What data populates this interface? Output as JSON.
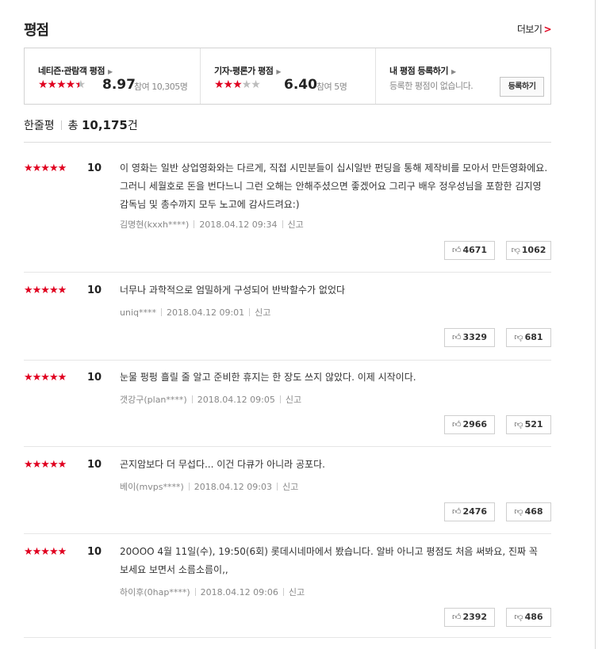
{
  "header": {
    "title": "평점",
    "more_label": "더보기",
    "more_arrow": ">"
  },
  "rating_box": {
    "netizen": {
      "label": "네티즌·관람객 평점",
      "score": "8.97",
      "participants": "참여 10,305명",
      "stars": 4.5
    },
    "critic": {
      "label": "기자·평론가 평점",
      "score": "6.40",
      "participants": "참여 5명",
      "stars": 3
    },
    "my": {
      "label": "내 평점 등록하기",
      "note": "등록한 평점이 없습니다.",
      "button": "등록하기"
    }
  },
  "summary": {
    "label": "한줄평",
    "total_prefix": "총",
    "total_count": "10,175",
    "total_suffix": "건"
  },
  "colors": {
    "accent": "#e0001f",
    "star_off": "#bdbdbd"
  },
  "reviews": [
    {
      "stars": "★★★★★",
      "score": "10",
      "text": "이 영화는 일반 상업영화와는 다르게, 직접 시민분들이 십시일반 펀딩을 통해 제작비를 모아서 만든영화에요.그러니 세월호로 돈을 번다느니 그런 오해는 안해주셨으면 좋겠어요 그리구 배우 정우성님을 포함한 김지영감독님 및 총수까지 모두 노고에 감사드려요:)",
      "author": "김명현(kxxh****)",
      "date": "2018.04.12 09:34",
      "report": "신고",
      "likes": "4671",
      "dislikes": "1062"
    },
    {
      "stars": "★★★★★",
      "score": "10",
      "text": "너무나 과학적으로 엄밀하게 구성되어 반박할수가 없었다",
      "author": "uniq****",
      "date": "2018.04.12 09:01",
      "report": "신고",
      "likes": "3329",
      "dislikes": "681"
    },
    {
      "stars": "★★★★★",
      "score": "10",
      "text": "눈물 펑펑 흘릴 줄 알고 준비한 휴지는 한 장도 쓰지 않았다. 이제 시작이다.",
      "author": "갯강구(plan****)",
      "date": "2018.04.12 09:05",
      "report": "신고",
      "likes": "2966",
      "dislikes": "521"
    },
    {
      "stars": "★★★★★",
      "score": "10",
      "text": "곤지암보다 더 무섭다... 이건 다큐가 아니라 공포다.",
      "author": "베이(mvps****)",
      "date": "2018.04.12 09:03",
      "report": "신고",
      "likes": "2476",
      "dislikes": "468"
    },
    {
      "stars": "★★★★★",
      "score": "10",
      "text": "20OOO 4월 11일(수), 19:50(6회) 롯데시네마에서 봤습니다. 알바 아니고 평점도 처음 써봐요, 진짜 꼭 보세요 보면서 소름소름이,,",
      "author": "하이후(0hap****)",
      "date": "2018.04.12 09:06",
      "report": "신고",
      "likes": "2392",
      "dislikes": "486"
    }
  ]
}
